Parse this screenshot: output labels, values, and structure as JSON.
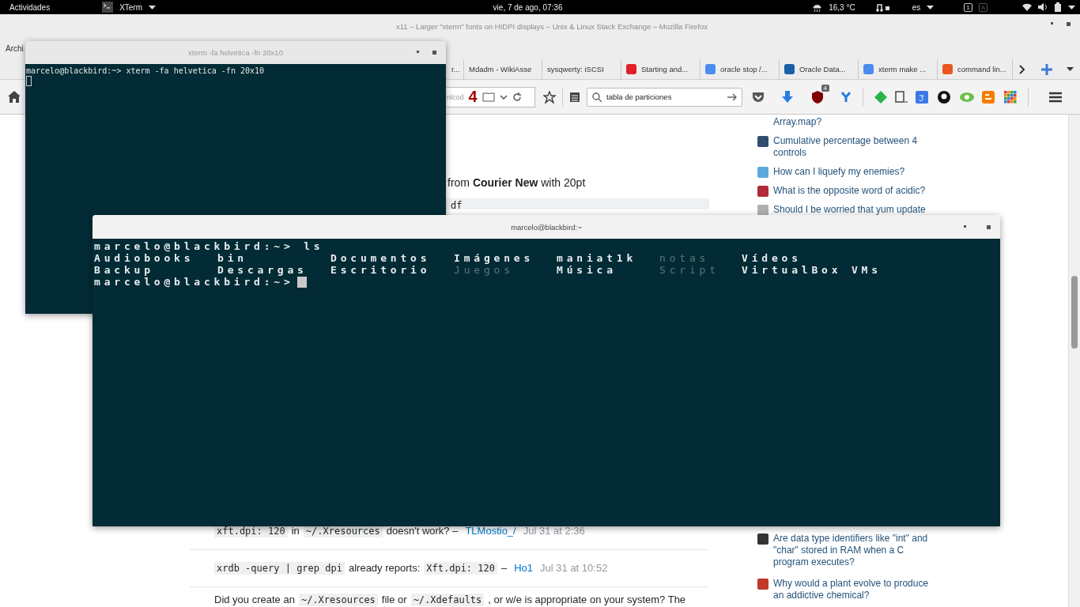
{
  "top_bar": {
    "activities": "Actividades",
    "app_menu": "XTerm",
    "clock": "vie,  7 de ago, 07:36",
    "weather": "16,3 °C",
    "keyboard_layout": "es",
    "indicators": [
      "1",
      "A"
    ]
  },
  "browser": {
    "title": "x11 – Larger \"xterm\" fonts on HIDPI displays – Unix & Linux Stack Exchange – Mozilla Firefox",
    "menu": [
      "Archi"
    ],
    "tabs": [
      {
        "label": "r..."
      },
      {
        "label": "Mdadm - WikiAsse"
      },
      {
        "label": "sysqwerty: iSCSI"
      },
      {
        "label": "Starting and...",
        "color": "#e0202a"
      },
      {
        "label": "oracle stop /...",
        "color": "#4a8cf0"
      },
      {
        "label": "Oracle Data...",
        "color": "#1b5fa8"
      },
      {
        "label": "xterm make ...",
        "color": "#4a8cf0"
      },
      {
        "label": "command lin...",
        "color": "#e8581c"
      }
    ],
    "url_fragment": "nlcod",
    "addon_count": "4",
    "search": {
      "value": "tabla de particiones"
    },
    "ublock_badge": "4",
    "page": {
      "intro": "from **Courier New** with 20pt",
      "code_fragment": "df",
      "comments": [
        {
          "parts": [
            {
              "kind": "code",
              "text": "xft.dpi: 120"
            },
            {
              "kind": "text",
              "text": "in"
            },
            {
              "kind": "code",
              "text": "~/.Xresources"
            },
            {
              "kind": "text",
              "text": "doesn't work? –"
            }
          ],
          "user": "TLMostio_/",
          "time": "Jul 31 at 2:36"
        },
        {
          "parts": [
            {
              "kind": "code",
              "text": "xrdb -query | grep dpi"
            },
            {
              "kind": "text",
              "text": "already reports:"
            },
            {
              "kind": "code",
              "text": "Xft.dpi: 120"
            },
            {
              "kind": "text",
              "text": "–"
            }
          ],
          "user": "Ho1",
          "time": "Jul 31 at 10:52"
        }
      ],
      "answer": [
        {
          "kind": "text",
          "text": "Did you create an"
        },
        {
          "kind": "code",
          "text": "~/.Xresources"
        },
        {
          "kind": "text",
          "text": "file or"
        },
        {
          "kind": "code",
          "text": "~/.Xdefaults"
        },
        {
          "kind": "text",
          "text": ", or w/e is appropriate on your system? The"
        }
      ]
    },
    "related_top": [
      {
        "label": "Array.map?"
      },
      {
        "label": "Cumulative percentage between 4 controls",
        "color": "#2f4f6f"
      },
      {
        "label": "How can I liquefy my enemies?",
        "color": "#5fa8dc"
      },
      {
        "label": "What is the opposite word of acidic?",
        "color": "#b02a37"
      },
      {
        "label": "Should I be worried that yum update",
        "color": "#b0b0b0"
      }
    ],
    "related_bottom": [
      {
        "label": "Are data type identifiers like \"int\" and \"char\" stored in RAM when a C program executes?",
        "color": "#333333"
      },
      {
        "label": "Why would a plant evolve to produce an addictive chemical?",
        "color": "#c0392b"
      }
    ]
  },
  "terminal_small": {
    "title": "xterm -fa helvetica -fn 20x10",
    "focused": false,
    "lines": [
      "marcelo@blackbird:~> xterm -fa helvetica -fn 20x10"
    ]
  },
  "terminal_main": {
    "title": "marcelo@blackbird:~",
    "focused": true,
    "command_line": "marcelo@blackbird:~> ls",
    "listing": [
      {
        "entries": [
          {
            "name": "Audiobooks",
            "dimmed": false
          },
          {
            "name": "bin",
            "dimmed": false
          },
          {
            "name": "Documentos",
            "dimmed": false
          },
          {
            "name": "Imágenes",
            "dimmed": false
          },
          {
            "name": "maniat1k",
            "dimmed": false
          },
          {
            "name": "notas",
            "dimmed": true
          },
          {
            "name": "Vídeos",
            "dimmed": false
          }
        ]
      },
      {
        "entries": [
          {
            "name": "Backup",
            "dimmed": false
          },
          {
            "name": "Descargas",
            "dimmed": false
          },
          {
            "name": "Escritorio",
            "dimmed": false
          },
          {
            "name": "Juegos",
            "dimmed": true
          },
          {
            "name": "Música",
            "dimmed": false
          },
          {
            "name": "Script",
            "dimmed": true
          },
          {
            "name": "VirtualBox VMs",
            "dimmed": false
          }
        ]
      }
    ],
    "prompt": "marcelo@blackbird:~>"
  }
}
